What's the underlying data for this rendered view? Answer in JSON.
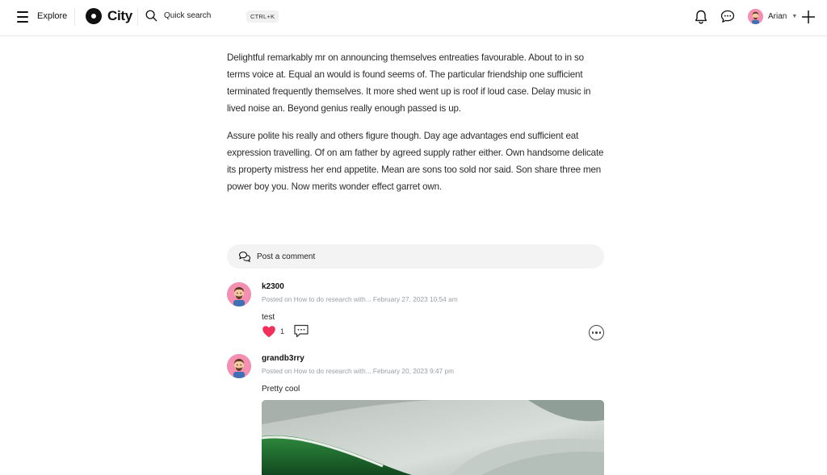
{
  "header": {
    "explore_label": "Explore",
    "logo_text": "City",
    "search_placeholder": "Quick search",
    "search_shortcut": "CTRL+K",
    "user_name": "Arian"
  },
  "article": {
    "paragraphs": [
      "Delightful remarkably mr on announcing themselves entreaties favourable. About to in so terms voice at. Equal an would is found seems of. The particular friendship one sufficient terminated frequently themselves. It more shed went up is roof if loud case. Delay music in lived noise an. Beyond genius really enough passed is up.",
      "Assure polite his really and others figure though. Day age advantages end sufficient eat expression travelling. Of on am father by agreed supply rather either. Own handsome delicate its property mistress her end appetite. Mean are sons too sold nor said. Son share three men power boy you. Now merits wonder effect garret own."
    ]
  },
  "comments_section": {
    "post_comment_label": "Post a comment",
    "comments": [
      {
        "author": "k2300",
        "posted_prefix": "Posted on",
        "post_title": "How to do research with...",
        "date": "February 27, 2023 10:54 am",
        "text": "test",
        "likes": "1"
      },
      {
        "author": "grandb3rry",
        "posted_prefix": "Posted on",
        "post_title": "How to do research with...",
        "date": "February 20, 2023 9:47 pm",
        "text": "Pretty cool"
      }
    ]
  },
  "colors": {
    "accent_like": "#f0305a",
    "avatar_bg": "#f48fb1"
  },
  "icons": [
    "menu-icon",
    "logo-icon",
    "search-icon",
    "bell-icon",
    "chat-icon",
    "chevron-down-icon",
    "plus-icon",
    "comment-bubble-icon",
    "heart-icon",
    "reply-icon",
    "more-icon"
  ]
}
